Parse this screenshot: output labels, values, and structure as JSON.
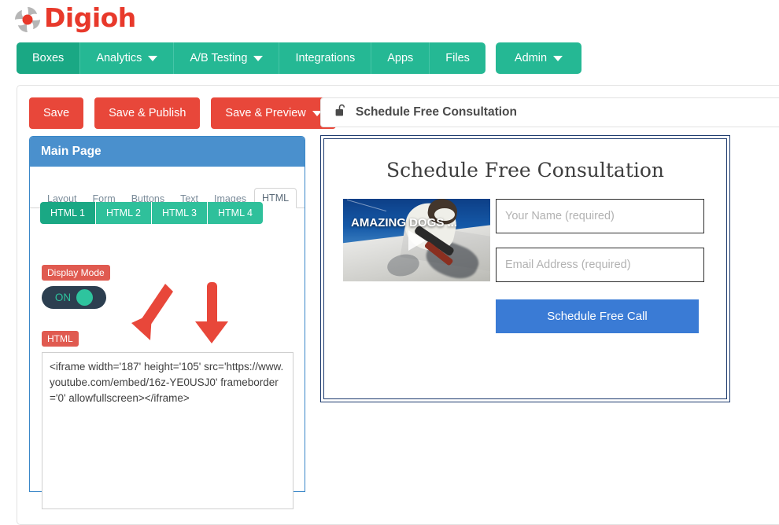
{
  "brand": {
    "name": "Digioh",
    "logo_icon": "digioh-pinwheel-icon",
    "logo_color": "#e8392b"
  },
  "nav": {
    "items": [
      {
        "label": "Boxes",
        "active": true,
        "caret": false
      },
      {
        "label": "Analytics",
        "active": false,
        "caret": true
      },
      {
        "label": "A/B Testing",
        "active": false,
        "caret": true
      },
      {
        "label": "Integrations",
        "active": false,
        "caret": false
      },
      {
        "label": "Apps",
        "active": false,
        "caret": false
      },
      {
        "label": "Files",
        "active": false,
        "caret": false
      }
    ],
    "admin": {
      "label": "Admin",
      "caret": true
    },
    "accent": "#25b894",
    "accent_active": "#1aa884"
  },
  "actions": {
    "save": "Save",
    "save_publish": "Save & Publish",
    "save_preview": "Save & Preview",
    "color": "#e8473a"
  },
  "editor": {
    "header": "Main Page",
    "header_color": "#4a90cd",
    "tabs": [
      {
        "label": "Layout",
        "active": false
      },
      {
        "label": "Form",
        "active": false
      },
      {
        "label": "Buttons",
        "active": false
      },
      {
        "label": "Text",
        "active": false
      },
      {
        "label": "Images",
        "active": false
      },
      {
        "label": "HTML",
        "active": true
      }
    ],
    "html_slots": [
      {
        "label": "HTML 1",
        "active": true
      },
      {
        "label": "HTML 2",
        "active": false
      },
      {
        "label": "HTML 3",
        "active": false
      },
      {
        "label": "HTML 4",
        "active": false
      }
    ],
    "display_mode_label": "Display Mode",
    "toggle_state": "ON",
    "html_label": "HTML",
    "html_code": "<iframe width='187' height='105' src='https://www.youtube.com/embed/16z-YE0USJ0' frameborder='0' allowfullscreen></iframe>"
  },
  "annotations": {
    "arrow_width_target": "187",
    "arrow_height_target": "105",
    "arrow_color": "#e8473a"
  },
  "preview": {
    "titlebar_icon": "unlock-icon",
    "titlebar_text": "Schedule Free Consultation",
    "heading": "Schedule Free Consultation",
    "video": {
      "caption": "AMAZING DOGS ...",
      "play_icon": "play-icon",
      "width": "187",
      "height": "105"
    },
    "fields": [
      {
        "placeholder": "Your Name (required)"
      },
      {
        "placeholder": "Email Address (required)"
      }
    ],
    "submit_label": "Schedule Free Call",
    "submit_color": "#3a7bd5",
    "border_color": "#1c3a6e"
  }
}
